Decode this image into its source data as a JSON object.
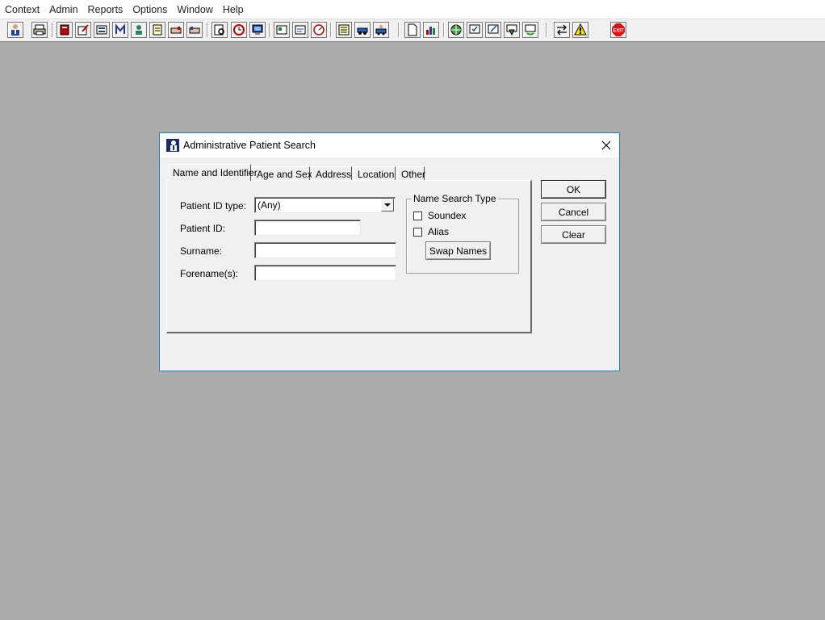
{
  "menu": [
    "Context",
    "Admin",
    "Reports",
    "Options",
    "Window",
    "Help"
  ],
  "toolbar": {
    "buttons": [
      {
        "icon": "user-icon"
      },
      {
        "icon": "printer-icon"
      },
      {
        "icon": "book-icon"
      },
      {
        "icon": "edit-icon"
      },
      {
        "icon": "document-icon"
      },
      {
        "icon": "letter-m-icon"
      },
      {
        "icon": "person-icon"
      },
      {
        "icon": "notes-icon"
      },
      {
        "icon": "hand-icon"
      },
      {
        "icon": "hand-point-icon"
      },
      {
        "icon": "search-doc-icon"
      },
      {
        "icon": "clock-icon"
      },
      {
        "icon": "monitor-icon"
      },
      {
        "icon": "card-icon"
      },
      {
        "icon": "card-edit-icon"
      },
      {
        "icon": "gauge-icon"
      },
      {
        "icon": "list-icon"
      },
      {
        "icon": "car-icon"
      },
      {
        "icon": "car-person-icon"
      },
      {
        "icon": "page-icon"
      },
      {
        "icon": "bar-chart-icon"
      },
      {
        "icon": "globe-icon"
      },
      {
        "icon": "form-check-icon"
      },
      {
        "icon": "form-edit-icon"
      },
      {
        "icon": "down-arrow-green-icon"
      },
      {
        "icon": "refresh-green-icon"
      },
      {
        "icon": "swap-icon"
      },
      {
        "icon": "warning-icon"
      },
      {
        "icon": "exit-icon"
      }
    ],
    "exit_label": "EXIT"
  },
  "dialog": {
    "title": "Administrative Patient Search",
    "tabs": [
      "Name and Identifier",
      "Age and Sex",
      "Address",
      "Location",
      "Other"
    ],
    "fields": {
      "patient_id_type_label": "Patient ID type:",
      "patient_id_type_value": "(Any)",
      "patient_id_label": "Patient ID:",
      "patient_id_value": "",
      "surname_label": "Surname:",
      "surname_value": "",
      "forename_label": "Forename(s):",
      "forename_value": ""
    },
    "name_search": {
      "title": "Name Search Type",
      "soundex": "Soundex",
      "alias": "Alias",
      "swap_names": "Swap Names"
    },
    "buttons": {
      "ok": "OK",
      "cancel": "Cancel",
      "clear": "Clear"
    }
  }
}
